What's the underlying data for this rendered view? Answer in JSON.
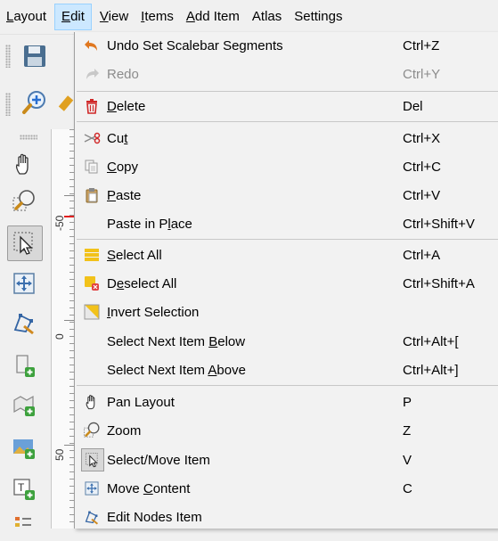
{
  "menubar": {
    "items": [
      {
        "name": "layout",
        "label": "Layout",
        "u": "L",
        "rest": "ayout"
      },
      {
        "name": "edit",
        "label": "Edit",
        "u": "E",
        "rest": "dit"
      },
      {
        "name": "view",
        "label": "View",
        "u": "V",
        "rest": "iew"
      },
      {
        "name": "items",
        "label": "Items",
        "u": "I",
        "rest": "tems"
      },
      {
        "name": "add-item",
        "label": "Add Item",
        "u": "A",
        "rest": "dd Item"
      },
      {
        "name": "atlas",
        "label": "Atlas"
      },
      {
        "name": "settings",
        "label": "Settings"
      }
    ],
    "active": "Edit"
  },
  "ruler": {
    "labels": [
      "-50",
      "0",
      "50"
    ]
  },
  "edit_menu": {
    "undo": {
      "label": "Undo Set Scalebar Segments",
      "shortcut": "Ctrl+Z"
    },
    "redo": {
      "label": "Redo",
      "shortcut": "Ctrl+Y"
    },
    "delete": {
      "pre": "",
      "u": "D",
      "post": "elete",
      "shortcut": "Del"
    },
    "cut": {
      "pre": "Cu",
      "u": "t",
      "post": "",
      "shortcut": "Ctrl+X"
    },
    "copy": {
      "pre": "",
      "u": "C",
      "post": "opy",
      "shortcut": "Ctrl+C"
    },
    "paste": {
      "pre": "",
      "u": "P",
      "post": "aste",
      "shortcut": "Ctrl+V"
    },
    "paste_in_place": {
      "pre": "Paste in P",
      "u": "l",
      "post": "ace",
      "shortcut": "Ctrl+Shift+V"
    },
    "select_all": {
      "pre": "",
      "u": "S",
      "post": "elect All",
      "shortcut": "Ctrl+A"
    },
    "deselect_all": {
      "pre": "D",
      "u": "e",
      "post": "select All",
      "shortcut": "Ctrl+Shift+A"
    },
    "invert_selection": {
      "pre": "",
      "u": "I",
      "post": "nvert Selection",
      "shortcut": ""
    },
    "select_next_below": {
      "pre": "Select Next Item ",
      "u": "B",
      "post": "elow",
      "shortcut": "Ctrl+Alt+["
    },
    "select_next_above": {
      "pre": "Select Next Item ",
      "u": "A",
      "post": "bove",
      "shortcut": "Ctrl+Alt+]"
    },
    "pan_layout": {
      "label": "Pan Layout",
      "shortcut": "P"
    },
    "zoom": {
      "label": "Zoom",
      "shortcut": "Z"
    },
    "select_move": {
      "label": "Select/Move Item",
      "shortcut": "V"
    },
    "move_content": {
      "pre": "Move ",
      "u": "C",
      "post": "ontent",
      "shortcut": "C"
    },
    "edit_nodes": {
      "label": "Edit Nodes Item",
      "shortcut": ""
    }
  },
  "colors": {
    "accent": "#cce8ff",
    "accent_border": "#99d1ff",
    "menu_bg": "#f2f2f2",
    "ruler_mark": "#e02020"
  }
}
